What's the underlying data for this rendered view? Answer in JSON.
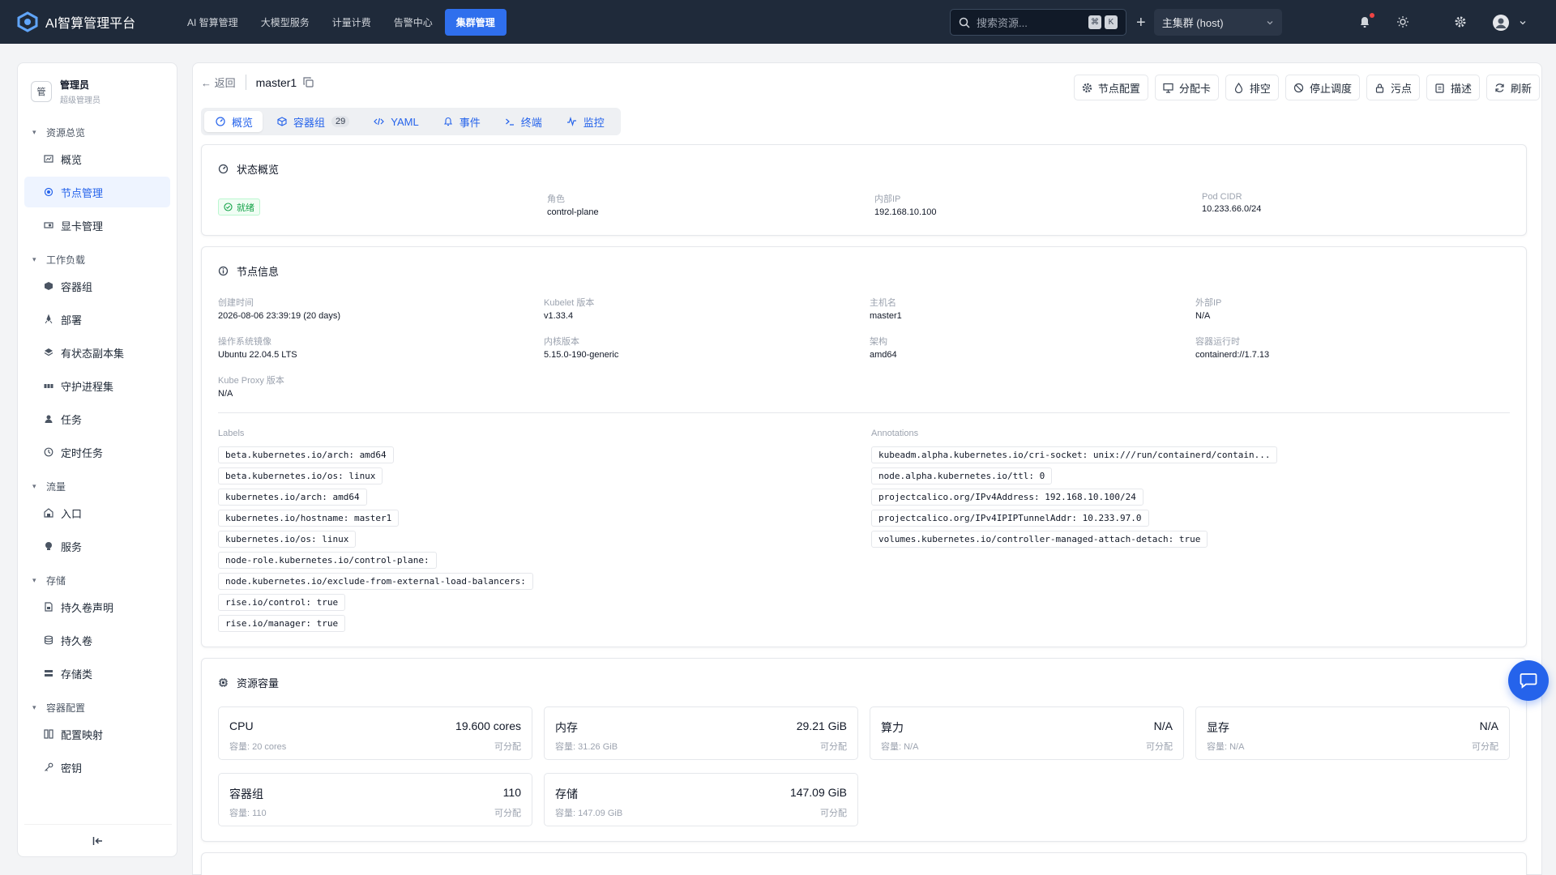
{
  "brand": {
    "title": "AI智算管理平台"
  },
  "topnav": [
    {
      "label": "AI 智算管理"
    },
    {
      "label": "大模型服务"
    },
    {
      "label": "计量计费"
    },
    {
      "label": "告警中心"
    },
    {
      "label": "集群管理"
    }
  ],
  "search": {
    "placeholder": "搜索资源...",
    "kbd1": "⌘",
    "kbd2": "K"
  },
  "cluster": {
    "selected": "主集群 (host)"
  },
  "user": {
    "avatar": "管",
    "name": "管理员",
    "role": "超级管理员"
  },
  "sidebar": {
    "groups": [
      {
        "label": "资源总览",
        "items": [
          {
            "label": "概览"
          },
          {
            "label": "节点管理"
          },
          {
            "label": "显卡管理"
          }
        ]
      },
      {
        "label": "工作负载",
        "items": [
          {
            "label": "容器组"
          },
          {
            "label": "部署"
          },
          {
            "label": "有状态副本集"
          },
          {
            "label": "守护进程集"
          },
          {
            "label": "任务"
          },
          {
            "label": "定时任务"
          }
        ]
      },
      {
        "label": "流量",
        "items": [
          {
            "label": "入口"
          },
          {
            "label": "服务"
          }
        ]
      },
      {
        "label": "存储",
        "items": [
          {
            "label": "持久卷声明"
          },
          {
            "label": "持久卷"
          },
          {
            "label": "存储类"
          }
        ]
      },
      {
        "label": "容器配置",
        "items": [
          {
            "label": "配置映射"
          },
          {
            "label": "密钥"
          }
        ]
      }
    ],
    "collapse_icon": "collapse-left-icon"
  },
  "header": {
    "back": "返回",
    "node_name": "master1"
  },
  "actions": [
    {
      "label": "节点配置"
    },
    {
      "label": "分配卡"
    },
    {
      "label": "排空"
    },
    {
      "label": "停止调度"
    },
    {
      "label": "污点"
    },
    {
      "label": "描述"
    },
    {
      "label": "刷新"
    }
  ],
  "tabs": [
    {
      "label": "概览"
    },
    {
      "label": "容器组",
      "badge": "29"
    },
    {
      "label": "YAML"
    },
    {
      "label": "事件"
    },
    {
      "label": "终端"
    },
    {
      "label": "监控"
    }
  ],
  "status": {
    "title": "状态概览",
    "ready": "就绪",
    "role_label": "角色",
    "role": "control-plane",
    "ip_label": "内部IP",
    "ip": "192.168.10.100",
    "cidr_label": "Pod CIDR",
    "cidr": "10.233.66.0/24"
  },
  "info": {
    "title": "节点信息",
    "fields": [
      {
        "k": "创建时间",
        "v": "2026-08-06 23:39:19 (20 days)"
      },
      {
        "k": "Kubelet 版本",
        "v": "v1.33.4"
      },
      {
        "k": "主机名",
        "v": "master1"
      },
      {
        "k": "外部IP",
        "v": "N/A"
      },
      {
        "k": "操作系统镜像",
        "v": "Ubuntu 22.04.5 LTS"
      },
      {
        "k": "内核版本",
        "v": "5.15.0-190-generic"
      },
      {
        "k": "架构",
        "v": "amd64"
      },
      {
        "k": "容器运行时",
        "v": "containerd://1.7.13"
      },
      {
        "k": "Kube Proxy 版本",
        "v": "N/A"
      }
    ],
    "labels_title": "Labels",
    "labels": [
      "beta.kubernetes.io/arch: amd64",
      "beta.kubernetes.io/os: linux",
      "kubernetes.io/arch: amd64",
      "kubernetes.io/hostname: master1",
      "kubernetes.io/os: linux",
      "node-role.kubernetes.io/control-plane:",
      "node.kubernetes.io/exclude-from-external-load-balancers:",
      "rise.io/control: true",
      "rise.io/manager: true"
    ],
    "annotations_title": "Annotations",
    "annotations": [
      "kubeadm.alpha.kubernetes.io/cri-socket: unix:///run/containerd/contain...",
      "node.alpha.kubernetes.io/ttl: 0",
      "projectcalico.org/IPv4Address: 192.168.10.100/24",
      "projectcalico.org/IPv4IPIPTunnelAddr: 10.233.97.0",
      "volumes.kubernetes.io/controller-managed-attach-detach: true"
    ]
  },
  "capacity": {
    "title": "资源容量",
    "alloc_label": "可分配",
    "items": [
      {
        "name": "CPU",
        "value": "19.600 cores",
        "cap": "容量: 20 cores"
      },
      {
        "name": "内存",
        "value": "29.21 GiB",
        "cap": "容量: 31.26 GiB"
      },
      {
        "name": "算力",
        "value": "N/A",
        "cap": "容量: N/A"
      },
      {
        "name": "显存",
        "value": "N/A",
        "cap": "容量: N/A"
      },
      {
        "name": "容器组",
        "value": "110",
        "cap": "容量: 110"
      },
      {
        "name": "存储",
        "value": "147.09 GiB",
        "cap": "容量: 147.09 GiB"
      }
    ]
  },
  "colors": {
    "accent": "#2563eb",
    "topbar": "#1f2a3a",
    "ready": "#16a34a"
  }
}
